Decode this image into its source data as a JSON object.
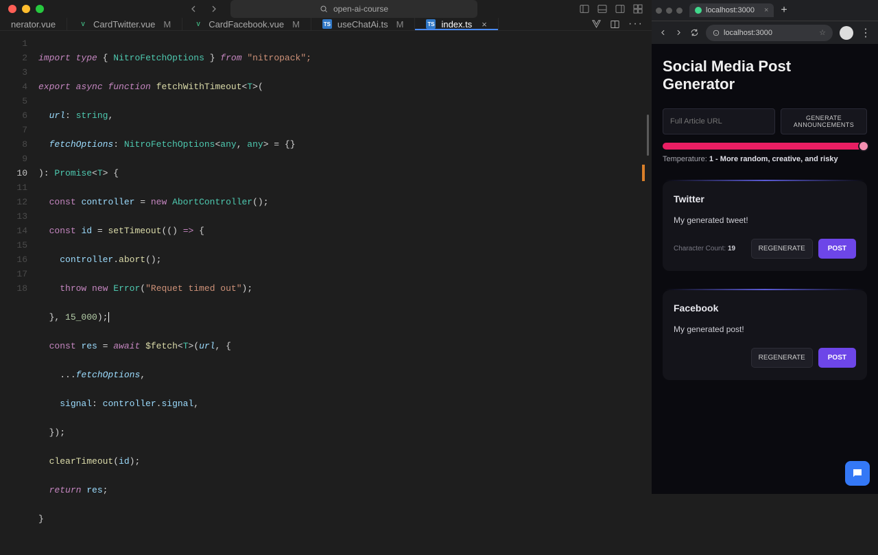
{
  "titlebar": {
    "project": "open-ai-course"
  },
  "tabs": [
    {
      "icon": "vue",
      "label": "nerator.vue",
      "mod": ""
    },
    {
      "icon": "vue",
      "label": "CardTwitter.vue",
      "mod": "M"
    },
    {
      "icon": "vue",
      "label": "CardFacebook.vue",
      "mod": "M"
    },
    {
      "icon": "ts",
      "label": "useChatAi.ts",
      "mod": "M"
    },
    {
      "icon": "ts",
      "label": "index.ts",
      "mod": "",
      "active": true
    }
  ],
  "gutter": [
    "1",
    "2",
    "3",
    "4",
    "5",
    "6",
    "7",
    "8",
    "9",
    "10",
    "11",
    "12",
    "13",
    "14",
    "15",
    "16",
    "17",
    "18"
  ],
  "current_line": 10,
  "code": {
    "l1": {
      "a": "import",
      "b": "type",
      "c": "{ ",
      "d": "NitroFetchOptions",
      "e": " } ",
      "f": "from",
      "g": " \"nitropack\";"
    },
    "l2": {
      "a": "export",
      "b": "async",
      "c": "function",
      "d": "fetchWithTimeout",
      "e": "<",
      "f": "T",
      "g": ">("
    },
    "l3": {
      "a": "url",
      "b": ": ",
      "c": "string",
      "d": ","
    },
    "l4": {
      "a": "fetchOptions",
      "b": ": ",
      "c": "NitroFetchOptions",
      "d": "<",
      "e": "any",
      "f": ", ",
      "g": "any",
      "h": "> = {}"
    },
    "l5": {
      "a": "): ",
      "b": "Promise",
      "c": "<",
      "d": "T",
      "e": "> {"
    },
    "l6": {
      "a": "const",
      "b": "controller",
      "c": " = ",
      "d": "new",
      "e": "AbortController",
      "f": "();"
    },
    "l7": {
      "a": "const",
      "b": "id",
      "c": " = ",
      "d": "setTimeout",
      "e": "(() ",
      "f": "=>",
      "g": " {"
    },
    "l8": {
      "a": "controller",
      "b": ".",
      "c": "abort",
      "d": "();"
    },
    "l9": {
      "a": "throw",
      "b": "new",
      "c": "Error",
      "d": "(",
      "e": "\"Requet timed out\"",
      "f": ");"
    },
    "l10": {
      "a": "}, ",
      "b": "15_000",
      "c": ");",
      "cur": "|"
    },
    "l11": {
      "a": "const",
      "b": "res",
      "c": " = ",
      "d": "await",
      "e": "$fetch",
      "f": "<",
      "g": "T",
      "h": ">(",
      "i": "url",
      "j": ", {"
    },
    "l12": {
      "a": "...",
      "b": "fetchOptions",
      "c": ","
    },
    "l13": {
      "a": "signal",
      "b": ": ",
      "c": "controller",
      "d": ".",
      "e": "signal",
      "f": ","
    },
    "l14": {
      "a": "});"
    },
    "l15": {
      "a": "clearTimeout",
      "b": "(",
      "c": "id",
      "d": ");"
    },
    "l16": {
      "a": "return",
      "b": "res",
      "c": ";"
    },
    "l17": {
      "a": "}"
    }
  },
  "browser": {
    "tab_label": "localhost:3000",
    "url": "localhost:3000"
  },
  "app": {
    "title": "Social Media Post Generator",
    "url_placeholder": "Full Article URL",
    "generate_label": "GENERATE ANNOUNCEMENTS",
    "temp_label": "Temperature: ",
    "temp_value": "1",
    "temp_desc": " - More random, creative, and risky",
    "twitter": {
      "title": "Twitter",
      "body": "My generated tweet!",
      "count_label": "Character Count: ",
      "count": "19",
      "regen": "REGENERATE",
      "post": "POST"
    },
    "facebook": {
      "title": "Facebook",
      "body": "My generated post!",
      "regen": "REGENERATE",
      "post": "POST"
    }
  }
}
